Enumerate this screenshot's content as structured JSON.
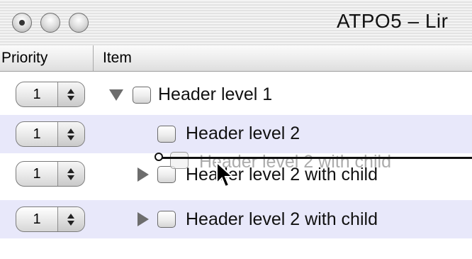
{
  "window": {
    "title": "ATPO5 – Lir"
  },
  "columns": {
    "priority": "Priority",
    "item": "Item"
  },
  "rows": [
    {
      "priority": "1",
      "label": "Header level 1",
      "disclosure": "open"
    },
    {
      "priority": "",
      "label": "Header level 2",
      "disclosure": "none"
    },
    {
      "priority": "1",
      "label": "Header level 2 with child",
      "disclosure": "closed"
    },
    {
      "priority": "1",
      "label": "Header level 2 with child",
      "disclosure": "closed"
    }
  ],
  "row1_priority": "1",
  "drag": {
    "ghost_label": "Header level 2 with child"
  },
  "colors": {
    "alt_row": "#e8e8fa",
    "disclosure": "#6d6d6d"
  }
}
